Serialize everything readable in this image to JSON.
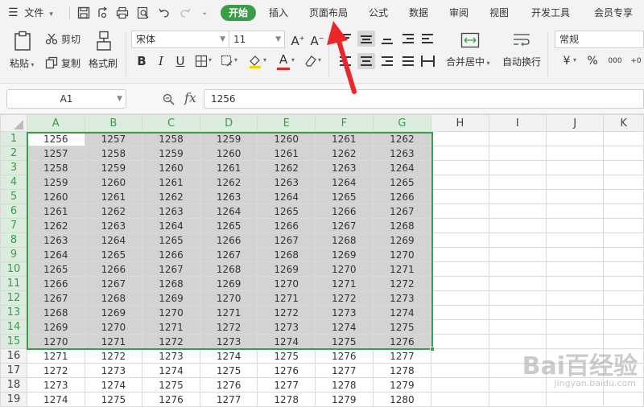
{
  "menubar": {
    "file_label": "文件",
    "tabs": [
      {
        "label": "开始",
        "active": true
      },
      {
        "label": "插入"
      },
      {
        "label": "页面布局"
      },
      {
        "label": "公式"
      },
      {
        "label": "数据"
      },
      {
        "label": "审阅"
      },
      {
        "label": "视图"
      },
      {
        "label": "开发工具"
      },
      {
        "label": "会员专享"
      }
    ]
  },
  "ribbon": {
    "paste_label": "粘贴",
    "cut_label": "剪切",
    "copy_label": "复制",
    "format_painter_label": "格式刷",
    "font_name": "宋体",
    "font_size": "11",
    "merge_center_label": "合并居中",
    "wrap_text_label": "自动换行",
    "number_format": "常规",
    "percent_symbol": "%",
    "comma_symbol": "000"
  },
  "formula_bar": {
    "name_box": "A1",
    "fx_label": "fx",
    "formula": "1256"
  },
  "sheet": {
    "columns": [
      "A",
      "B",
      "C",
      "D",
      "E",
      "F",
      "G",
      "H",
      "I",
      "J",
      "K"
    ],
    "rows": [
      [
        "1256",
        "1257",
        "1258",
        "1259",
        "1260",
        "1261",
        "1262"
      ],
      [
        "1257",
        "1258",
        "1259",
        "1260",
        "1261",
        "1262",
        "1263"
      ],
      [
        "1258",
        "1259",
        "1260",
        "1261",
        "1262",
        "1263",
        "1264"
      ],
      [
        "1259",
        "1260",
        "1261",
        "1262",
        "1263",
        "1264",
        "1265"
      ],
      [
        "1260",
        "1261",
        "1262",
        "1263",
        "1264",
        "1265",
        "1266"
      ],
      [
        "1261",
        "1262",
        "1263",
        "1264",
        "1265",
        "1266",
        "1267"
      ],
      [
        "1262",
        "1263",
        "1264",
        "1265",
        "1266",
        "1267",
        "1268"
      ],
      [
        "1263",
        "1264",
        "1265",
        "1266",
        "1267",
        "1268",
        "1269"
      ],
      [
        "1264",
        "1265",
        "1266",
        "1267",
        "1268",
        "1269",
        "1270"
      ],
      [
        "1265",
        "1266",
        "1267",
        "1268",
        "1269",
        "1270",
        "1271"
      ],
      [
        "1266",
        "1267",
        "1268",
        "1269",
        "1270",
        "1271",
        "1272"
      ],
      [
        "1267",
        "1268",
        "1269",
        "1270",
        "1271",
        "1272",
        "1273"
      ],
      [
        "1268",
        "1269",
        "1270",
        "1271",
        "1272",
        "1273",
        "1274"
      ],
      [
        "1269",
        "1270",
        "1271",
        "1272",
        "1273",
        "1274",
        "1275"
      ],
      [
        "1270",
        "1271",
        "1272",
        "1273",
        "1274",
        "1275",
        "1276"
      ],
      [
        "1271",
        "1272",
        "1273",
        "1274",
        "1275",
        "1276",
        "1277"
      ],
      [
        "1272",
        "1273",
        "1274",
        "1275",
        "1276",
        "1277",
        "1278"
      ],
      [
        "1273",
        "1274",
        "1275",
        "1276",
        "1277",
        "1278",
        "1279"
      ],
      [
        "1274",
        "1275",
        "1276",
        "1277",
        "1278",
        "1279",
        "1280"
      ]
    ],
    "selected_rows": 15,
    "selected_cols": 7
  },
  "watermark": {
    "text": "Bai百经验",
    "subtext": "jingyan.baidu.com"
  },
  "colors": {
    "accent": "#3a9d4a",
    "annotation": "#e8262b",
    "selection_fill": "#d3d3d3"
  }
}
